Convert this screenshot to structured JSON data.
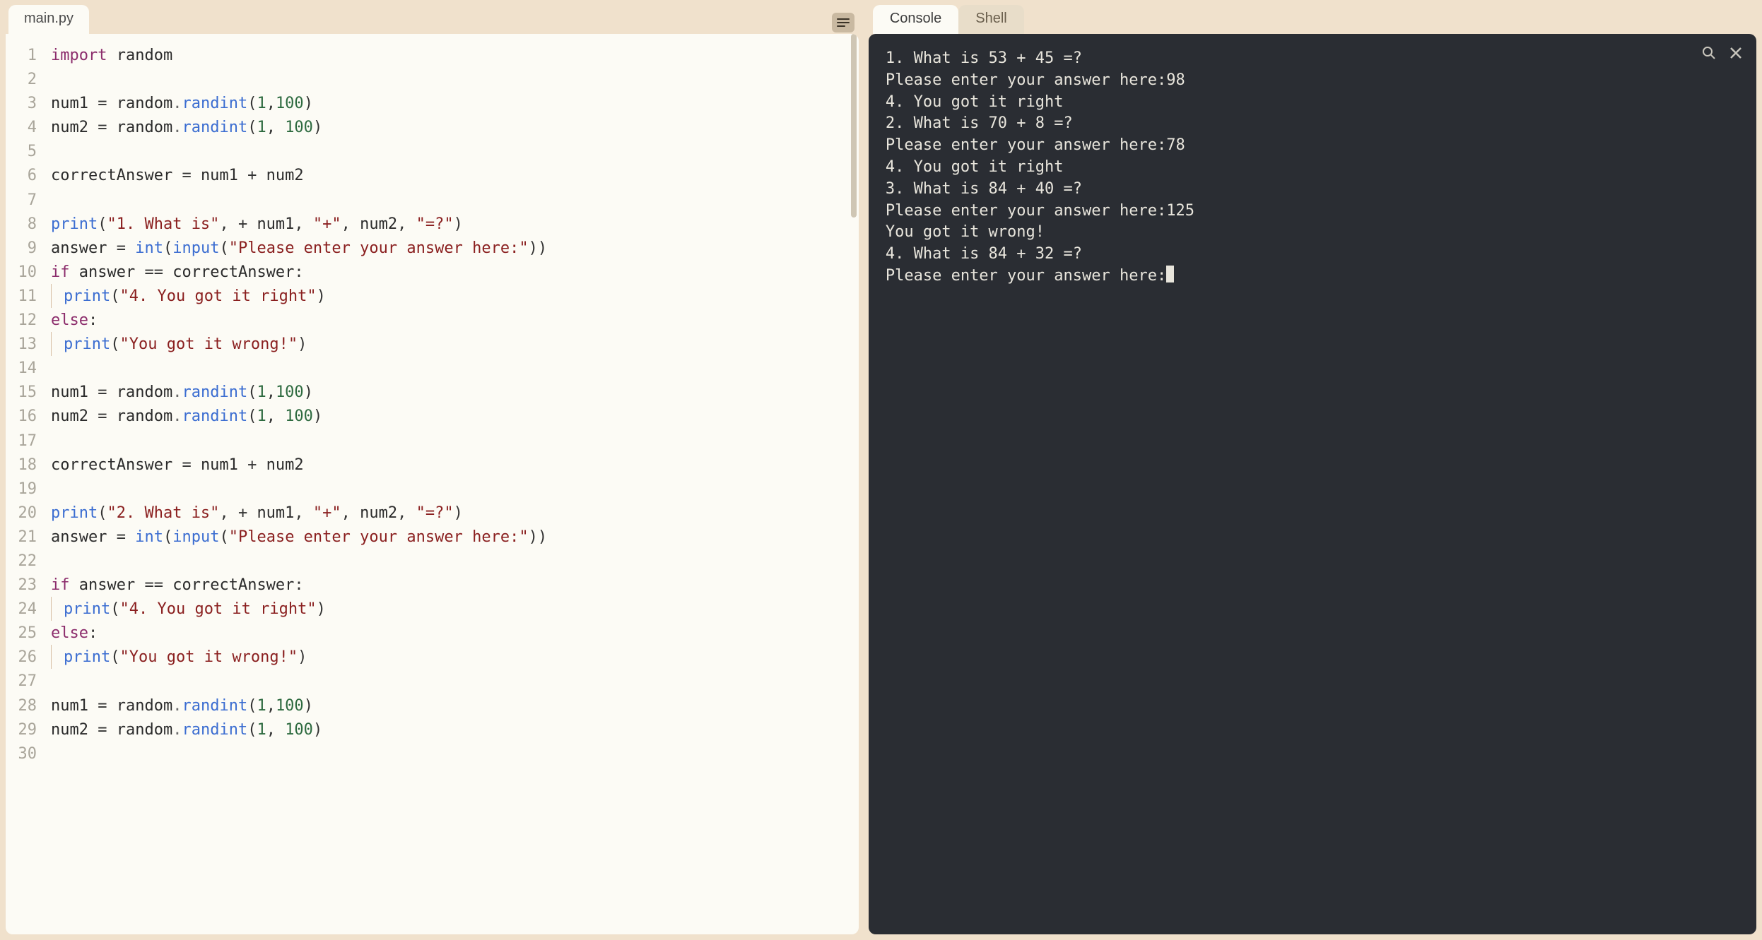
{
  "editor": {
    "tab_label": "main.py",
    "line_count": 30,
    "code_lines": [
      {
        "n": 1,
        "t": [
          [
            "kw",
            "import"
          ],
          [
            "sp",
            " "
          ],
          [
            "mod",
            "random"
          ]
        ]
      },
      {
        "n": 2,
        "t": []
      },
      {
        "n": 3,
        "t": [
          [
            "mod",
            "num1"
          ],
          [
            "sp",
            " "
          ],
          [
            "op",
            "="
          ],
          [
            "sp",
            " "
          ],
          [
            "mod",
            "random"
          ],
          [
            "dot",
            "."
          ],
          [
            "fn",
            "randint"
          ],
          [
            "op",
            "("
          ],
          [
            "num",
            "1"
          ],
          [
            "op",
            ","
          ],
          [
            "num",
            "100"
          ],
          [
            "op",
            ")"
          ]
        ]
      },
      {
        "n": 4,
        "t": [
          [
            "mod",
            "num2"
          ],
          [
            "sp",
            " "
          ],
          [
            "op",
            "="
          ],
          [
            "sp",
            " "
          ],
          [
            "mod",
            "random"
          ],
          [
            "dot",
            "."
          ],
          [
            "fn",
            "randint"
          ],
          [
            "op",
            "("
          ],
          [
            "num",
            "1"
          ],
          [
            "op",
            ","
          ],
          [
            "sp",
            " "
          ],
          [
            "num",
            "100"
          ],
          [
            "op",
            ")"
          ]
        ]
      },
      {
        "n": 5,
        "t": []
      },
      {
        "n": 6,
        "t": [
          [
            "mod",
            "correctAnswer"
          ],
          [
            "sp",
            " "
          ],
          [
            "op",
            "="
          ],
          [
            "sp",
            " "
          ],
          [
            "mod",
            "num1"
          ],
          [
            "sp",
            " "
          ],
          [
            "op",
            "+"
          ],
          [
            "sp",
            " "
          ],
          [
            "mod",
            "num2"
          ]
        ]
      },
      {
        "n": 7,
        "t": []
      },
      {
        "n": 8,
        "t": [
          [
            "fn",
            "print"
          ],
          [
            "op",
            "("
          ],
          [
            "str",
            "\"1. What is\""
          ],
          [
            "op",
            ","
          ],
          [
            "sp",
            " "
          ],
          [
            "op",
            "+"
          ],
          [
            "sp",
            " "
          ],
          [
            "mod",
            "num1"
          ],
          [
            "op",
            ","
          ],
          [
            "sp",
            " "
          ],
          [
            "str",
            "\"+\""
          ],
          [
            "op",
            ","
          ],
          [
            "sp",
            " "
          ],
          [
            "mod",
            "num2"
          ],
          [
            "op",
            ","
          ],
          [
            "sp",
            " "
          ],
          [
            "str",
            "\"=?\""
          ],
          [
            "op",
            ")"
          ]
        ]
      },
      {
        "n": 9,
        "t": [
          [
            "mod",
            "answer"
          ],
          [
            "sp",
            " "
          ],
          [
            "op",
            "="
          ],
          [
            "sp",
            " "
          ],
          [
            "fn",
            "int"
          ],
          [
            "op",
            "("
          ],
          [
            "fn",
            "input"
          ],
          [
            "op",
            "("
          ],
          [
            "str",
            "\"Please enter your answer here:\""
          ],
          [
            "op",
            ")"
          ],
          [
            "op",
            ")"
          ]
        ]
      },
      {
        "n": 10,
        "t": [
          [
            "kw",
            "if"
          ],
          [
            "sp",
            " "
          ],
          [
            "mod",
            "answer"
          ],
          [
            "sp",
            " "
          ],
          [
            "op",
            "=="
          ],
          [
            "sp",
            " "
          ],
          [
            "mod",
            "correctAnswer"
          ],
          [
            "op",
            ":"
          ]
        ]
      },
      {
        "n": 11,
        "indent": true,
        "t": [
          [
            "fn",
            "print"
          ],
          [
            "op",
            "("
          ],
          [
            "str",
            "\"4. You got it right\""
          ],
          [
            "op",
            ")"
          ]
        ]
      },
      {
        "n": 12,
        "t": [
          [
            "kw",
            "else"
          ],
          [
            "op",
            ":"
          ]
        ]
      },
      {
        "n": 13,
        "indent": true,
        "t": [
          [
            "fn",
            "print"
          ],
          [
            "op",
            "("
          ],
          [
            "str",
            "\"You got it wrong!\""
          ],
          [
            "op",
            ")"
          ]
        ]
      },
      {
        "n": 14,
        "t": []
      },
      {
        "n": 15,
        "t": [
          [
            "mod",
            "num1"
          ],
          [
            "sp",
            " "
          ],
          [
            "op",
            "="
          ],
          [
            "sp",
            " "
          ],
          [
            "mod",
            "random"
          ],
          [
            "dot",
            "."
          ],
          [
            "fn",
            "randint"
          ],
          [
            "op",
            "("
          ],
          [
            "num",
            "1"
          ],
          [
            "op",
            ","
          ],
          [
            "num",
            "100"
          ],
          [
            "op",
            ")"
          ]
        ]
      },
      {
        "n": 16,
        "t": [
          [
            "mod",
            "num2"
          ],
          [
            "sp",
            " "
          ],
          [
            "op",
            "="
          ],
          [
            "sp",
            " "
          ],
          [
            "mod",
            "random"
          ],
          [
            "dot",
            "."
          ],
          [
            "fn",
            "randint"
          ],
          [
            "op",
            "("
          ],
          [
            "num",
            "1"
          ],
          [
            "op",
            ","
          ],
          [
            "sp",
            " "
          ],
          [
            "num",
            "100"
          ],
          [
            "op",
            ")"
          ]
        ]
      },
      {
        "n": 17,
        "t": []
      },
      {
        "n": 18,
        "t": [
          [
            "mod",
            "correctAnswer"
          ],
          [
            "sp",
            " "
          ],
          [
            "op",
            "="
          ],
          [
            "sp",
            " "
          ],
          [
            "mod",
            "num1"
          ],
          [
            "sp",
            " "
          ],
          [
            "op",
            "+"
          ],
          [
            "sp",
            " "
          ],
          [
            "mod",
            "num2"
          ]
        ]
      },
      {
        "n": 19,
        "t": []
      },
      {
        "n": 20,
        "t": [
          [
            "fn",
            "print"
          ],
          [
            "op",
            "("
          ],
          [
            "str",
            "\"2. What is\""
          ],
          [
            "op",
            ","
          ],
          [
            "sp",
            " "
          ],
          [
            "op",
            "+"
          ],
          [
            "sp",
            " "
          ],
          [
            "mod",
            "num1"
          ],
          [
            "op",
            ","
          ],
          [
            "sp",
            " "
          ],
          [
            "str",
            "\"+\""
          ],
          [
            "op",
            ","
          ],
          [
            "sp",
            " "
          ],
          [
            "mod",
            "num2"
          ],
          [
            "op",
            ","
          ],
          [
            "sp",
            " "
          ],
          [
            "str",
            "\"=?\""
          ],
          [
            "op",
            ")"
          ]
        ]
      },
      {
        "n": 21,
        "t": [
          [
            "mod",
            "answer"
          ],
          [
            "sp",
            " "
          ],
          [
            "op",
            "="
          ],
          [
            "sp",
            " "
          ],
          [
            "fn",
            "int"
          ],
          [
            "op",
            "("
          ],
          [
            "fn",
            "input"
          ],
          [
            "op",
            "("
          ],
          [
            "str",
            "\"Please enter your answer here:\""
          ],
          [
            "op",
            ")"
          ],
          [
            "op",
            ")"
          ]
        ]
      },
      {
        "n": 22,
        "t": []
      },
      {
        "n": 23,
        "t": [
          [
            "kw",
            "if"
          ],
          [
            "sp",
            " "
          ],
          [
            "mod",
            "answer"
          ],
          [
            "sp",
            " "
          ],
          [
            "op",
            "=="
          ],
          [
            "sp",
            " "
          ],
          [
            "mod",
            "correctAnswer"
          ],
          [
            "op",
            ":"
          ]
        ]
      },
      {
        "n": 24,
        "indent": true,
        "t": [
          [
            "fn",
            "print"
          ],
          [
            "op",
            "("
          ],
          [
            "str",
            "\"4. You got it right\""
          ],
          [
            "op",
            ")"
          ]
        ]
      },
      {
        "n": 25,
        "t": [
          [
            "kw",
            "else"
          ],
          [
            "op",
            ":"
          ]
        ]
      },
      {
        "n": 26,
        "indent": true,
        "t": [
          [
            "fn",
            "print"
          ],
          [
            "op",
            "("
          ],
          [
            "str",
            "\"You got it wrong!\""
          ],
          [
            "op",
            ")"
          ]
        ]
      },
      {
        "n": 27,
        "t": []
      },
      {
        "n": 28,
        "t": [
          [
            "mod",
            "num1"
          ],
          [
            "sp",
            " "
          ],
          [
            "op",
            "="
          ],
          [
            "sp",
            " "
          ],
          [
            "mod",
            "random"
          ],
          [
            "dot",
            "."
          ],
          [
            "fn",
            "randint"
          ],
          [
            "op",
            "("
          ],
          [
            "num",
            "1"
          ],
          [
            "op",
            ","
          ],
          [
            "num",
            "100"
          ],
          [
            "op",
            ")"
          ]
        ]
      },
      {
        "n": 29,
        "t": [
          [
            "mod",
            "num2"
          ],
          [
            "sp",
            " "
          ],
          [
            "op",
            "="
          ],
          [
            "sp",
            " "
          ],
          [
            "mod",
            "random"
          ],
          [
            "dot",
            "."
          ],
          [
            "fn",
            "randint"
          ],
          [
            "op",
            "("
          ],
          [
            "num",
            "1"
          ],
          [
            "op",
            ","
          ],
          [
            "sp",
            " "
          ],
          [
            "num",
            "100"
          ],
          [
            "op",
            ")"
          ]
        ]
      },
      {
        "n": 30,
        "t": []
      }
    ]
  },
  "right_panel": {
    "tabs": {
      "console": "Console",
      "shell": "Shell"
    },
    "active_tab": "console"
  },
  "console": {
    "lines": [
      "1. What is 53 + 45 =?",
      "Please enter your answer here:98",
      "4. You got it right",
      "2. What is 70 + 8 =?",
      "Please enter your answer here:78",
      "4. You got it right",
      "3. What is 84 + 40 =?",
      "Please enter your answer here:125",
      "You got it wrong!",
      "4. What is 84 + 32 =?",
      "Please enter your answer here:"
    ],
    "cursor_after_last": true
  }
}
